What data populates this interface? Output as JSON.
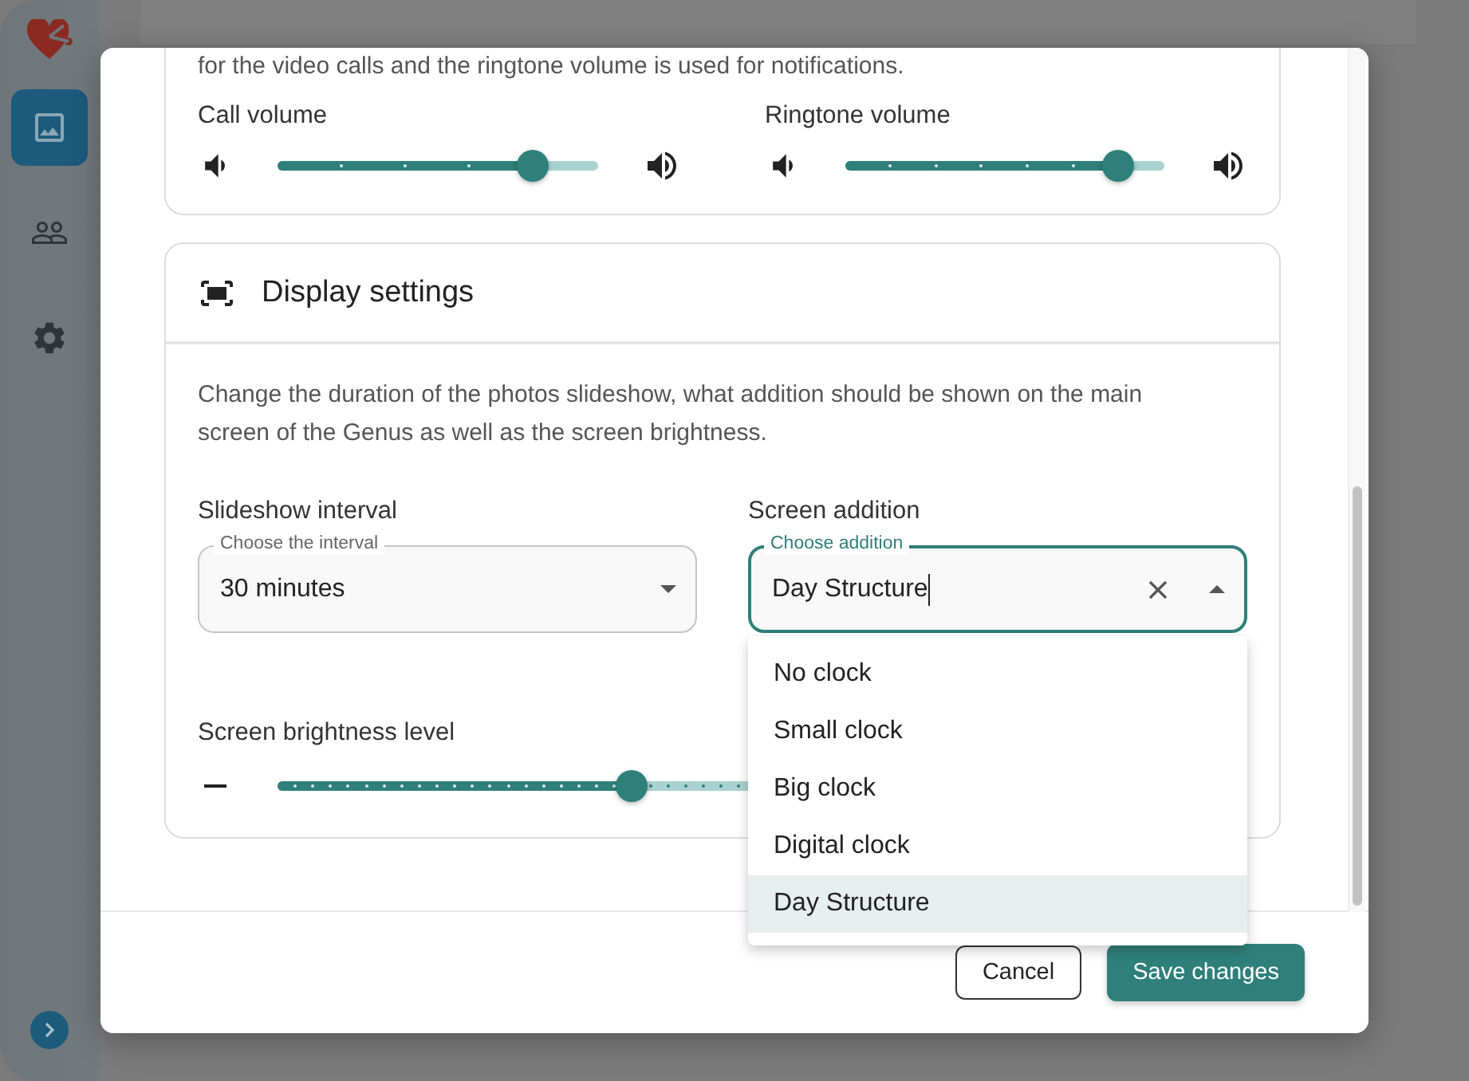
{
  "sidebar": {
    "items": [
      {
        "kind": "photos",
        "selected": true
      },
      {
        "kind": "people",
        "selected": false
      },
      {
        "kind": "settings",
        "selected": false
      }
    ]
  },
  "dialog": {
    "volume_section": {
      "description": "for the video calls and the ringtone volume is used for notifications.",
      "sliders": [
        {
          "label": "Call volume",
          "level": 0.8
        },
        {
          "label": "Ringtone volume",
          "level": 0.857
        }
      ]
    },
    "display_section": {
      "title": "Display settings",
      "description": "Change the duration of the photos slideshow, what addition should be shown on the main screen of the Genus as well as the screen brightness.",
      "slideshow": {
        "label": "Slideshow interval",
        "field_label": "Choose the interval",
        "value": "30 minutes"
      },
      "screen_addition": {
        "label": "Screen addition",
        "field_label": "Choose addition",
        "value": "Day Structure",
        "expanded": true,
        "options": [
          {
            "label": "No clock",
            "selected": false
          },
          {
            "label": "Small clock",
            "selected": false
          },
          {
            "label": "Big clock",
            "selected": false
          },
          {
            "label": "Digital clock",
            "selected": false
          },
          {
            "label": "Day Structure",
            "selected": true
          }
        ]
      },
      "brightness": {
        "label": "Screen brightness level",
        "level": 0.4
      }
    },
    "buttons": [
      {
        "label": "Cancel",
        "kind": "secondary"
      },
      {
        "label": "Save changes",
        "kind": "primary"
      }
    ]
  }
}
